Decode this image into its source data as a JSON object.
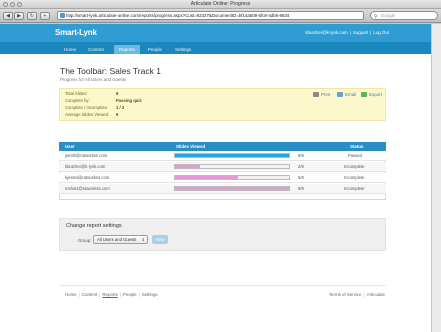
{
  "window": {
    "title": "Articulate Online: Progress"
  },
  "browser": {
    "url": "http://smart-lynk.articulate-online.com/reports/progress.aspx?Cust=92327&DocumentID=bf14a509-5fc8-4db6-8634",
    "search_placeholder": "Google"
  },
  "site": {
    "logo": "Smart-Lynk",
    "account": {
      "email": "kbutcher@k-lynk.com",
      "support": "Support",
      "logout": "Log Out"
    },
    "nav": [
      "Home",
      "Content",
      "Reports",
      "People",
      "Settings"
    ],
    "active_nav": "Reports"
  },
  "page": {
    "title": "The Toolbar: Sales Track 1",
    "subtitle": "Progress for All Users and Guests",
    "summary": [
      {
        "label": "Total Slides:",
        "value": "9"
      },
      {
        "label": "Complete by:",
        "value": "Passing quiz"
      },
      {
        "label": "Complete / Incomplete:",
        "value": "1 / 3"
      },
      {
        "label": "Average Slides Viewed:",
        "value": "6"
      }
    ],
    "actions": {
      "print": "Print",
      "email": "Email",
      "export": "Export"
    }
  },
  "table": {
    "headers": [
      "User",
      "Slides Viewed",
      "Status"
    ],
    "rows": [
      {
        "user": "jsmith@ratworkss.com",
        "viewed": "9/9",
        "fraction": 1.0,
        "status": "Passed"
      },
      {
        "user": "kbutcher@k-lynk.com",
        "viewed": "2/9",
        "fraction": 0.222,
        "status": "Incomplete"
      },
      {
        "user": "kjestes@ratworkss.com",
        "viewed": "5/9",
        "fraction": 0.556,
        "status": "Incomplete"
      },
      {
        "user": "mshutz@ratworkss.com",
        "viewed": "9/9",
        "fraction": 1.0,
        "status": "Incomplete"
      }
    ]
  },
  "settings": {
    "title": "Change report settings",
    "group_label": "Group:",
    "group_value": "All Users and Guests",
    "view_button": "View"
  },
  "footer": {
    "links": [
      "Home",
      "Content",
      "Reports",
      "People",
      "Settings"
    ],
    "current": "Reports",
    "right": [
      "Terms of Service",
      "Articulate"
    ]
  },
  "colors": {
    "header": "#2f9cd3",
    "nav": "#1a87bf",
    "bar_complete": "#25a5dd",
    "bar_partial": "#e39ad9"
  }
}
